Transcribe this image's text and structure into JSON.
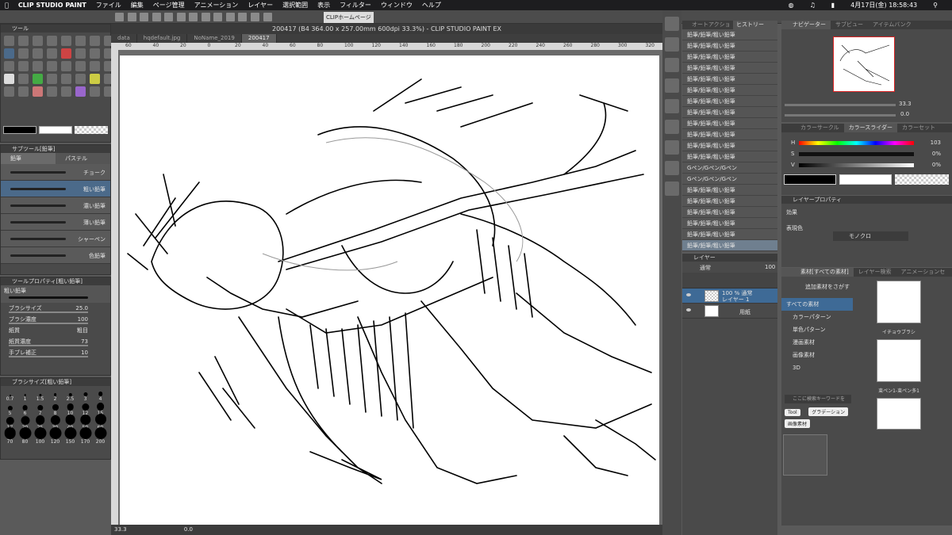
{
  "menubar": {
    "app_name": "CLIP STUDIO PAINT",
    "menus": [
      "ファイル",
      "編集",
      "ページ管理",
      "アニメーション",
      "レイヤー",
      "選択範囲",
      "表示",
      "フィルター",
      "ウィンドウ",
      "ヘルプ"
    ],
    "datetime": "4月17日(金)  18:58:43"
  },
  "command_bar": {
    "homepage_button": "CLIPホームページ"
  },
  "document": {
    "title": "200417 (B4 364.00 x 257.00mm 600dpi 33.3%)  - CLIP STUDIO PAINT EX",
    "tabs": [
      "data",
      "hqdefault.jpg",
      "NoName_2019",
      "200417"
    ],
    "active_tab": 3,
    "ruler_ticks": [
      "60",
      "40",
      "20",
      "0",
      "20",
      "40",
      "60",
      "80",
      "100",
      "120",
      "140",
      "160",
      "180",
      "200",
      "220",
      "240",
      "260",
      "280",
      "300",
      "320"
    ],
    "zoom": "33.3",
    "angle": "0.0"
  },
  "tool_panel": {
    "title": "ツール"
  },
  "subtool_panel": {
    "title": "サブツール[鉛筆]",
    "tabs": [
      "鉛筆",
      "パステル"
    ],
    "brushes": [
      {
        "label": "チョーク",
        "selected": false
      },
      {
        "label": "粗い鉛筆",
        "selected": true
      },
      {
        "label": "濃い鉛筆",
        "selected": false
      },
      {
        "label": "薄い鉛筆",
        "selected": false
      },
      {
        "label": "シャーペン",
        "selected": false
      },
      {
        "label": "色鉛筆",
        "selected": false
      }
    ]
  },
  "tool_property": {
    "title": "ツールプロパティ[粗い鉛筆]",
    "preset": "粗い鉛筆",
    "rows": [
      {
        "label": "ブラシサイズ",
        "value": "25.0",
        "level": 0.25
      },
      {
        "label": "ブラシ濃度",
        "value": "100",
        "level": 1.0
      },
      {
        "label": "紙質",
        "value": "粗目",
        "level": 0
      },
      {
        "label": "紙質濃度",
        "value": "73",
        "level": 0.73
      },
      {
        "label": "手ブレ補正",
        "value": "10",
        "level": 0.1
      }
    ]
  },
  "brush_size_panel": {
    "title": "ブラシサイズ[粗い鉛筆]",
    "sizes": [
      "0.7",
      "1",
      "1.5",
      "2",
      "2.5",
      "3",
      "4",
      "5",
      "6",
      "7",
      "8",
      "10",
      "12",
      "15",
      "17",
      "20",
      "25",
      "30",
      "40",
      "50",
      "60",
      "70",
      "80",
      "100",
      "120",
      "150",
      "170",
      "200"
    ]
  },
  "history": {
    "tabs": [
      "オートアクション",
      "ヒストリー"
    ],
    "items": [
      "鉛筆/鉛筆/粗い鉛筆",
      "鉛筆/鉛筆/粗い鉛筆",
      "鉛筆/鉛筆/粗い鉛筆",
      "鉛筆/鉛筆/粗い鉛筆",
      "鉛筆/鉛筆/粗い鉛筆",
      "鉛筆/鉛筆/粗い鉛筆",
      "鉛筆/鉛筆/粗い鉛筆",
      "鉛筆/鉛筆/粗い鉛筆",
      "鉛筆/鉛筆/粗い鉛筆",
      "鉛筆/鉛筆/粗い鉛筆",
      "鉛筆/鉛筆/粗い鉛筆",
      "鉛筆/鉛筆/粗い鉛筆",
      "Gペン/Gペン/Gペン",
      "Gペン/Gペン/Gペン",
      "鉛筆/鉛筆/粗い鉛筆",
      "鉛筆/鉛筆/粗い鉛筆",
      "鉛筆/鉛筆/粗い鉛筆",
      "鉛筆/鉛筆/粗い鉛筆",
      "鉛筆/鉛筆/粗い鉛筆",
      "鉛筆/鉛筆/粗い鉛筆"
    ],
    "selected_index": 19
  },
  "layer_panel": {
    "title": "レイヤー",
    "blend_mode": "通常",
    "opacity": "100",
    "layers": [
      {
        "line1": "100 % 通常",
        "line2": "レイヤー 1",
        "selected": true
      },
      {
        "line1": "",
        "line2": "用紙",
        "selected": false
      }
    ]
  },
  "navigator": {
    "tabs": [
      "ナビゲーター",
      "サブビュー",
      "アイテムバンク"
    ],
    "zoom": "33.3",
    "angle": "0.0"
  },
  "color_slider": {
    "tabs": [
      "カラーサークル",
      "カラースライダー",
      "カラーセット"
    ],
    "channels": [
      {
        "label": "H",
        "value": "103"
      },
      {
        "label": "S",
        "value": "0%"
      },
      {
        "label": "V",
        "value": "0%"
      }
    ]
  },
  "layer_property": {
    "title": "レイヤープロパティ",
    "effect_label": "効果",
    "expression_label": "表現色",
    "expression_value": "モノクロ"
  },
  "material_panel": {
    "tabs": [
      "素材[すべての素材]",
      "レイヤー検索",
      "アニメーションセ"
    ],
    "add_button": "追加素材をさがす",
    "tree": [
      {
        "label": "すべての素材",
        "selected": true
      },
      {
        "label": "カラーパターン",
        "selected": false
      },
      {
        "label": "単色パターン",
        "selected": false
      },
      {
        "label": "漫画素材",
        "selected": false
      },
      {
        "label": "画像素材",
        "selected": false
      },
      {
        "label": "3D",
        "selected": false
      }
    ],
    "search_placeholder": "ここに検索キーワードを",
    "tags": [
      "Tool",
      "グラデーション",
      "画像素材"
    ],
    "thumbs": [
      "イチョウブラシ",
      "束ペン1-束ペン多1"
    ]
  },
  "colors": {
    "accent": "#3e6a96",
    "desktop": "#2a5aa0"
  }
}
